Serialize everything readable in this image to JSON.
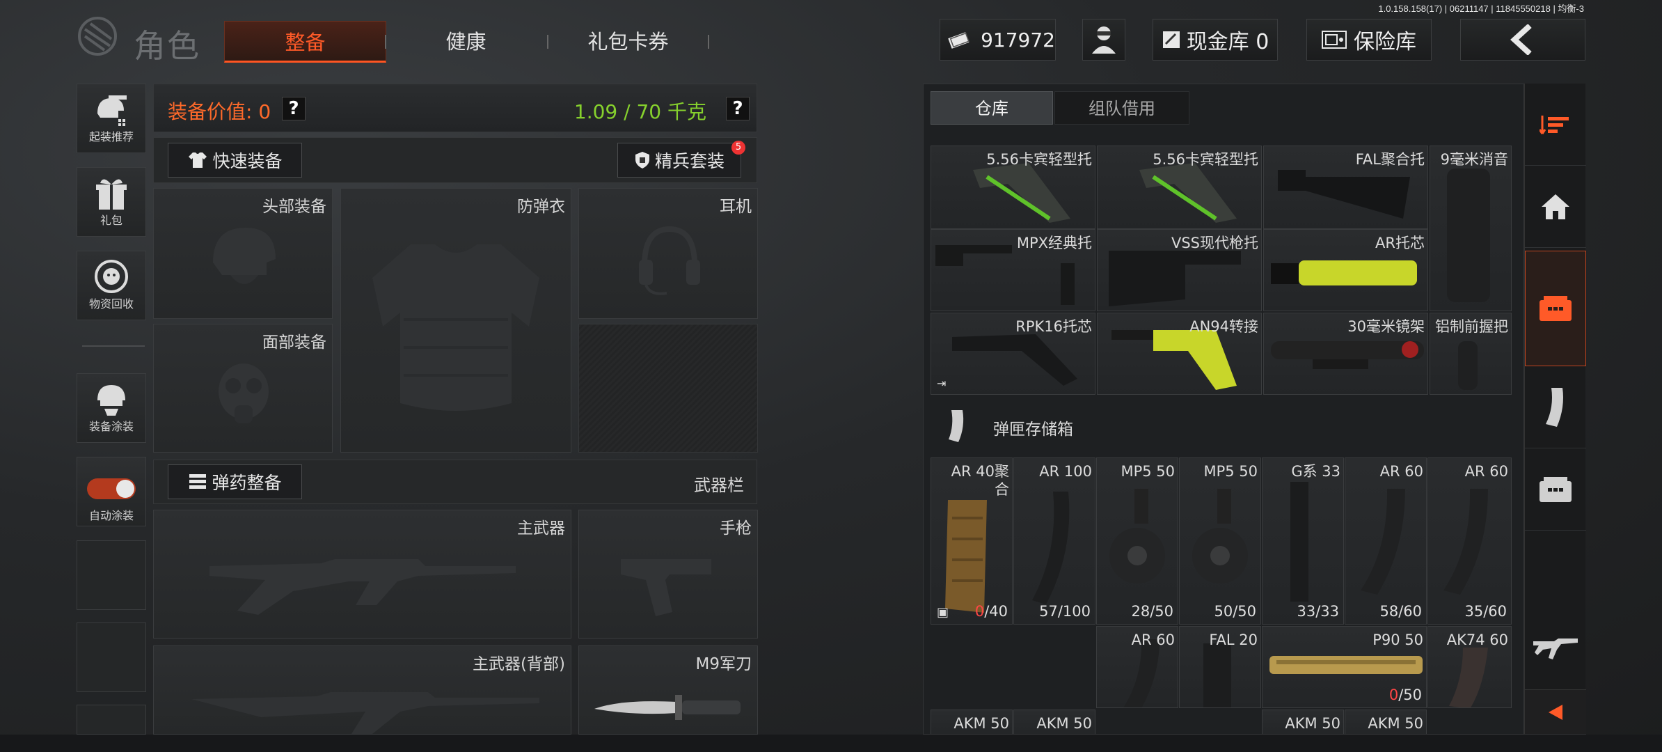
{
  "build_info": "1.0.158.158(17) | 06211147 | 11845550218 | 均衡-3",
  "header": {
    "title": "角色",
    "tabs": [
      {
        "label": "整备",
        "active": true
      },
      {
        "label": "健康",
        "active": false
      },
      {
        "label": "礼包卡券",
        "active": false
      }
    ],
    "money": "917972",
    "cash_vault": "现金库 0",
    "safe": "保险库"
  },
  "sidebar": {
    "items": [
      {
        "label": "起装推荐",
        "icon": "helmet-gun-icon"
      },
      {
        "label": "礼包",
        "icon": "gift-icon"
      },
      {
        "label": "物资回收",
        "icon": "recycle-icon"
      },
      {
        "label": "装备涂装",
        "icon": "paint-helmet-icon"
      },
      {
        "label": "自动涂装",
        "icon": "toggle-icon",
        "toggle_on": true
      }
    ]
  },
  "equipment": {
    "value_label": "装备价值: 0",
    "weight": "1.09 / 70 千克",
    "help": "?",
    "quick_equip": "快速装备",
    "elite_kit": "精兵套装",
    "elite_badge": "5",
    "ammo_equip": "弹药整备",
    "weapon_bar": "武器栏",
    "slots": {
      "head": "头部装备",
      "armor": "防弹衣",
      "headset": "耳机",
      "face": "面部装备",
      "primary": "主武器",
      "pistol": "手枪",
      "primary_back": "主武器(背部)",
      "knife": "M9军刀"
    }
  },
  "warehouse": {
    "tabs": [
      {
        "label": "仓库",
        "active": true
      },
      {
        "label": "组队借用",
        "active": false
      }
    ],
    "row1": [
      "5.56卡宾轻型托",
      "5.56卡宾轻型托",
      "FAL聚合托",
      "9毫米消音"
    ],
    "row2": [
      "MPX经典托",
      "VSS现代枪托",
      "AR托芯"
    ],
    "row3": [
      "RPK16托芯",
      "AN94转接",
      "30毫米镜架",
      "铝制前握把"
    ],
    "section_title": "弹匣存储箱",
    "mags_row1": [
      {
        "name": "AR 40聚合",
        "qty_cur": "0",
        "qty_max": "/40",
        "zero": true
      },
      {
        "name": "AR 100",
        "qty": "57/100"
      },
      {
        "name": "MP5 50",
        "qty": "28/50"
      },
      {
        "name": "MP5 50",
        "qty": "50/50"
      },
      {
        "name": "G系 33",
        "qty": "33/33"
      },
      {
        "name": "AR 60",
        "qty": "58/60"
      },
      {
        "name": "AR 60",
        "qty": "35/60"
      }
    ],
    "mags_row2": [
      {
        "name": "AR 60"
      },
      {
        "name": "FAL 20"
      },
      {
        "name": "P90 50",
        "qty_cur": "0",
        "qty_max": "/50",
        "zero": true
      },
      {
        "name": "AK74 60"
      }
    ],
    "mags_row3": [
      "AKM 50",
      "AKM 50",
      "AKM 50",
      "AKM 50"
    ]
  },
  "colors": {
    "accent": "#ff5a28",
    "weight_green": "#86d12d",
    "badge_red": "#e33333"
  }
}
